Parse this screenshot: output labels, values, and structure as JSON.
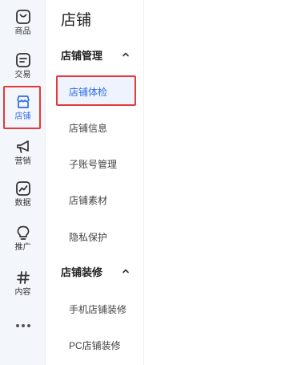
{
  "rail": {
    "items": [
      {
        "label": "商品",
        "icon": "goods-icon"
      },
      {
        "label": "交易",
        "icon": "trade-icon"
      },
      {
        "label": "店铺",
        "icon": "store-icon"
      },
      {
        "label": "营销",
        "icon": "megaphone-icon"
      },
      {
        "label": "数据",
        "icon": "chart-icon"
      },
      {
        "label": "推广",
        "icon": "lightbulb-icon"
      },
      {
        "label": "内容",
        "icon": "hash-icon"
      }
    ],
    "active": "店铺",
    "more_icon": "more-dots-icon"
  },
  "menu": {
    "title": "店铺",
    "groups": [
      {
        "label": "店铺管理",
        "items": [
          "店铺体检",
          "店铺信息",
          "子账号管理",
          "店铺素材",
          "隐私保护"
        ]
      },
      {
        "label": "店铺装修",
        "items": [
          "手机店铺装修",
          "PC店铺装修"
        ]
      }
    ],
    "active_item": "店铺体检"
  },
  "colors": {
    "accent": "#2e6be6",
    "highlight_border": "#e6393a",
    "rail_bg": "#f3f6fb"
  }
}
